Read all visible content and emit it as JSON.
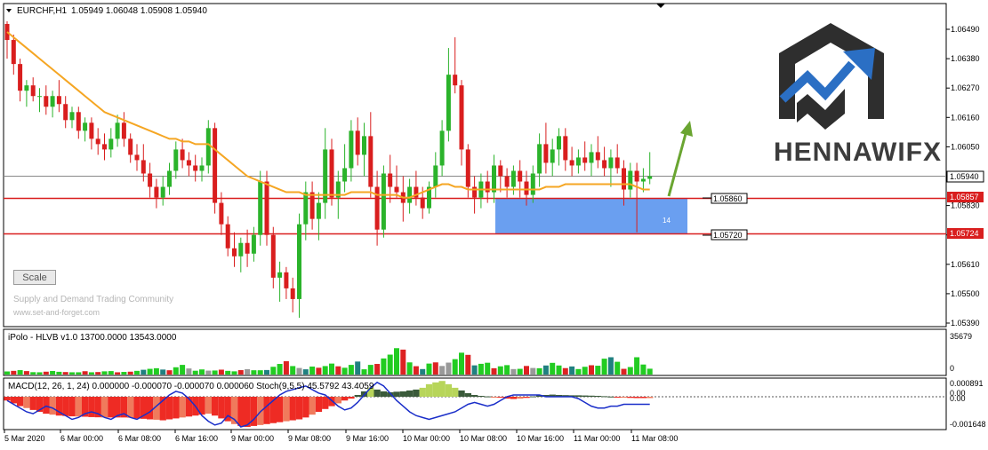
{
  "header": {
    "symbol_label": "EURCHF,H1",
    "ohlc": "1.05949 1.06048 1.05908 1.05940"
  },
  "colors": {
    "bull": "#2bb32b",
    "bear": "#d91e1e",
    "ma": "#f5a623",
    "support_line": "#d91e1e",
    "zone": "#6a9ff0",
    "arrow": "#6aa531",
    "macd_bar": "#ee2b24",
    "macd_bar_light": "#f07a5c",
    "stoch_main": "#1a2ec9",
    "stoch_signal": "#b7d55a",
    "vol_green": "#22cc22",
    "vol_red": "#dd2222",
    "vol_teal": "#208080",
    "vol_gray": "#999999"
  },
  "scale_button": "Scale",
  "watermark": {
    "line1": "Supply and Demand Trading Community",
    "line2": "www.set-and-forget.com"
  },
  "logo": {
    "text": "HENNAWIFX"
  },
  "zone_label": "14",
  "price_axis": {
    "ticks": [
      "1.06490",
      "1.06380",
      "1.06270",
      "1.06160",
      "1.06050",
      "1.05830",
      "1.05720",
      "1.05610",
      "1.05500",
      "1.05390"
    ],
    "current_price": "1.05940",
    "level_upper": "1.05857",
    "level_lower": "1.05724",
    "marker_upper": "1.05860",
    "marker_lower": "1.05720"
  },
  "time_axis": [
    "5 Mar 2020",
    "6 Mar 00:00",
    "6 Mar 08:00",
    "6 Mar 16:00",
    "9 Mar 00:00",
    "9 Mar 08:00",
    "9 Mar 16:00",
    "10 Mar 00:00",
    "10 Mar 08:00",
    "10 Mar 16:00",
    "11 Mar 00:00",
    "11 Mar 08:00"
  ],
  "volume_panel": {
    "title": "iPolo - HLVB v1.0 13700.0000 13543.0000",
    "max_label": "35679",
    "min_label": "0"
  },
  "macd_panel": {
    "title": "MACD(12, 26, 1, 24) 0.000000 -0.000070 -0.000070 0.000060  Stoch(9,5,5) 45.5792 43.4059",
    "top_label": "0.000891",
    "zero_label1": "0.00",
    "zero_label2": "0.00",
    "bottom_label": "-0.001648"
  },
  "chart_data": {
    "type": "candlestick",
    "symbol": "EURCHF",
    "timeframe": "H1",
    "y_axis_ticks": [
      1.0649,
      1.0638,
      1.0627,
      1.0616,
      1.0605,
      1.0583,
      1.0572,
      1.0561,
      1.055,
      1.0539
    ],
    "current_price": 1.0594,
    "support_levels": [
      1.05857,
      1.05724
    ],
    "support_markers": [
      1.0586,
      1.0572
    ],
    "candles": [
      [
        1.0651,
        1.0652,
        1.0638,
        1.0645
      ],
      [
        1.0645,
        1.0647,
        1.0632,
        1.0636
      ],
      [
        1.0636,
        1.0638,
        1.0622,
        1.0626
      ],
      [
        1.0626,
        1.063,
        1.062,
        1.0628
      ],
      [
        1.0628,
        1.0631,
        1.0622,
        1.0624
      ],
      [
        1.0624,
        1.0627,
        1.0618,
        1.0624
      ],
      [
        1.0624,
        1.0628,
        1.0617,
        1.062
      ],
      [
        1.062,
        1.0626,
        1.0616,
        1.0624
      ],
      [
        1.0624,
        1.063,
        1.0618,
        1.0621
      ],
      [
        1.0621,
        1.0624,
        1.0612,
        1.0615
      ],
      [
        1.0615,
        1.062,
        1.0612,
        1.0618
      ],
      [
        1.0618,
        1.062,
        1.0608,
        1.0611
      ],
      [
        1.0611,
        1.0616,
        1.0607,
        1.0614
      ],
      [
        1.0614,
        1.0616,
        1.0604,
        1.0608
      ],
      [
        1.0608,
        1.0612,
        1.0602,
        1.0606
      ],
      [
        1.0606,
        1.061,
        1.06,
        1.0604
      ],
      [
        1.0604,
        1.0612,
        1.0601,
        1.0608
      ],
      [
        1.0608,
        1.0617,
        1.0605,
        1.0614
      ],
      [
        1.0614,
        1.0618,
        1.0605,
        1.0608
      ],
      [
        1.0608,
        1.061,
        1.0599,
        1.0602
      ],
      [
        1.0602,
        1.0606,
        1.0596,
        1.06
      ],
      [
        1.06,
        1.0606,
        1.0592,
        1.0595
      ],
      [
        1.0595,
        1.0599,
        1.0586,
        1.059
      ],
      [
        1.059,
        1.0593,
        1.0582,
        1.0586
      ],
      [
        1.0586,
        1.0594,
        1.0583,
        1.059
      ],
      [
        1.059,
        1.0599,
        1.0587,
        1.0596
      ],
      [
        1.0596,
        1.0607,
        1.0593,
        1.0604
      ],
      [
        1.0604,
        1.0608,
        1.0597,
        1.06
      ],
      [
        1.06,
        1.0603,
        1.0594,
        1.0598
      ],
      [
        1.0598,
        1.0602,
        1.0592,
        1.0596
      ],
      [
        1.0596,
        1.0601,
        1.0592,
        1.0598
      ],
      [
        1.0598,
        1.0615,
        1.0595,
        1.0612
      ],
      [
        1.0612,
        1.0614,
        1.058,
        1.0584
      ],
      [
        1.0584,
        1.0588,
        1.0572,
        1.0576
      ],
      [
        1.0576,
        1.0579,
        1.0564,
        1.0567
      ],
      [
        1.0567,
        1.0573,
        1.056,
        1.0564
      ],
      [
        1.0564,
        1.0571,
        1.0558,
        1.0569
      ],
      [
        1.0569,
        1.0574,
        1.056,
        1.0565
      ],
      [
        1.0565,
        1.0575,
        1.0562,
        1.0572
      ],
      [
        1.0572,
        1.0596,
        1.0568,
        1.0592
      ],
      [
        1.0592,
        1.0596,
        1.0568,
        1.0572
      ],
      [
        1.0572,
        1.0575,
        1.0552,
        1.0556
      ],
      [
        1.0556,
        1.0562,
        1.0547,
        1.0558
      ],
      [
        1.0558,
        1.056,
        1.0548,
        1.0552
      ],
      [
        1.0552,
        1.0556,
        1.0543,
        1.0548
      ],
      [
        1.0548,
        1.058,
        1.0541,
        1.0576
      ],
      [
        1.0576,
        1.0592,
        1.057,
        1.0588
      ],
      [
        1.0588,
        1.0592,
        1.0574,
        1.0578
      ],
      [
        1.0578,
        1.0588,
        1.057,
        1.0584
      ],
      [
        1.0584,
        1.0612,
        1.0578,
        1.0604
      ],
      [
        1.0604,
        1.0608,
        1.0583,
        1.0586
      ],
      [
        1.0586,
        1.0596,
        1.0578,
        1.0592
      ],
      [
        1.0592,
        1.0606,
        1.0588,
        1.0597
      ],
      [
        1.0597,
        1.0615,
        1.0592,
        1.0611
      ],
      [
        1.0611,
        1.0616,
        1.0598,
        1.0602
      ],
      [
        1.0602,
        1.0614,
        1.0594,
        1.0609
      ],
      [
        1.0609,
        1.0618,
        1.0586,
        1.059
      ],
      [
        1.059,
        1.0596,
        1.0568,
        1.0574
      ],
      [
        1.0574,
        1.0598,
        1.0571,
        1.0595
      ],
      [
        1.0595,
        1.0602,
        1.0584,
        1.059
      ],
      [
        1.059,
        1.0598,
        1.0586,
        1.0588
      ],
      [
        1.0588,
        1.0594,
        1.0577,
        1.0584
      ],
      [
        1.0584,
        1.0593,
        1.058,
        1.059
      ],
      [
        1.059,
        1.0596,
        1.0583,
        1.0586
      ],
      [
        1.0586,
        1.059,
        1.0578,
        1.0582
      ],
      [
        1.0582,
        1.0592,
        1.058,
        1.059
      ],
      [
        1.059,
        1.0603,
        1.0586,
        1.0598
      ],
      [
        1.0598,
        1.0615,
        1.0594,
        1.0611
      ],
      [
        1.0611,
        1.0642,
        1.0607,
        1.0632
      ],
      [
        1.0632,
        1.0646,
        1.0625,
        1.0628
      ],
      [
        1.0628,
        1.063,
        1.0598,
        1.0604
      ],
      [
        1.0604,
        1.0606,
        1.0586,
        1.059
      ],
      [
        1.059,
        1.0594,
        1.058,
        1.0586
      ],
      [
        1.0586,
        1.0595,
        1.0582,
        1.0592
      ],
      [
        1.0592,
        1.0596,
        1.0584,
        1.0588
      ],
      [
        1.0588,
        1.0602,
        1.0584,
        1.0598
      ],
      [
        1.0598,
        1.06,
        1.0588,
        1.0594
      ],
      [
        1.0594,
        1.0597,
        1.0586,
        1.059
      ],
      [
        1.059,
        1.0598,
        1.0587,
        1.0596
      ],
      [
        1.0596,
        1.06,
        1.0586,
        1.0592
      ],
      [
        1.0592,
        1.0596,
        1.0583,
        1.0587
      ],
      [
        1.0587,
        1.0598,
        1.0584,
        1.0595
      ],
      [
        1.0595,
        1.061,
        1.059,
        1.0606
      ],
      [
        1.0606,
        1.0614,
        1.0595,
        1.0599
      ],
      [
        1.0599,
        1.0608,
        1.0594,
        1.0604
      ],
      [
        1.0604,
        1.0612,
        1.0598,
        1.0609
      ],
      [
        1.0609,
        1.0612,
        1.0596,
        1.06
      ],
      [
        1.06,
        1.0605,
        1.0594,
        1.0598
      ],
      [
        1.0598,
        1.0604,
        1.0595,
        1.0601
      ],
      [
        1.0601,
        1.0607,
        1.0596,
        1.0599
      ],
      [
        1.0599,
        1.0606,
        1.0594,
        1.0603
      ],
      [
        1.0603,
        1.0609,
        1.0597,
        1.06
      ],
      [
        1.06,
        1.0605,
        1.0594,
        1.0597
      ],
      [
        1.0597,
        1.0604,
        1.059,
        1.0601
      ],
      [
        1.0601,
        1.0606,
        1.0595,
        1.0597
      ],
      [
        1.0597,
        1.06,
        1.0583,
        1.0589
      ],
      [
        1.0589,
        1.0599,
        1.0586,
        1.0596
      ],
      [
        1.0596,
        1.0599,
        1.0573,
        1.0592
      ],
      [
        1.0592,
        1.0597,
        1.0588,
        1.0593
      ],
      [
        1.0593,
        1.0603,
        1.0591,
        1.0594
      ]
    ],
    "ma_values": [
      1.0648,
      1.0646,
      1.0644,
      1.0642,
      1.064,
      1.0638,
      1.0636,
      1.0634,
      1.0632,
      1.063,
      1.0628,
      1.0626,
      1.0624,
      1.0622,
      1.062,
      1.0618,
      1.0617,
      1.0616,
      1.0615,
      1.0614,
      1.0613,
      1.0612,
      1.0611,
      1.061,
      1.0609,
      1.0608,
      1.0608,
      1.0607,
      1.0607,
      1.0606,
      1.0606,
      1.0606,
      1.0604,
      1.0602,
      1.06,
      1.0598,
      1.0596,
      1.0594,
      1.0593,
      1.0592,
      1.0591,
      1.059,
      1.0589,
      1.0588,
      1.0588,
      1.0588,
      1.0587,
      1.0587,
      1.0587,
      1.0587,
      1.0587,
      1.0587,
      1.0587,
      1.0588,
      1.0588,
      1.0588,
      1.0588,
      1.0587,
      1.0587,
      1.0587,
      1.0587,
      1.0586,
      1.0586,
      1.0587,
      1.0588,
      1.0589,
      1.059,
      1.0591,
      1.0591,
      1.059,
      1.059,
      1.0589,
      1.0589,
      1.0589,
      1.0589,
      1.0589,
      1.0589,
      1.0589,
      1.0589,
      1.0589,
      1.0589,
      1.0589,
      1.0589,
      1.059,
      1.059,
      1.059,
      1.0591,
      1.0591,
      1.0591,
      1.0591,
      1.0591,
      1.0591,
      1.0591,
      1.0591,
      1.0591,
      1.0591,
      1.0591,
      1.059,
      1.0589,
      1.0589
    ],
    "volume_ylim": [
      0,
      35679
    ],
    "volume": [
      2600,
      3100,
      3700,
      2900,
      2000,
      1900,
      2400,
      3000,
      2300,
      2100,
      1900,
      1900,
      2800,
      1900,
      2100,
      2700,
      2900,
      1900,
      2200,
      2400,
      3100,
      4000,
      4800,
      5300,
      4200,
      3600,
      6100,
      8100,
      5100,
      3200,
      4300,
      3300,
      3400,
      4100,
      3100,
      2700,
      3700,
      4500,
      3600,
      3600,
      3800,
      6500,
      8900,
      11200,
      7100,
      5500,
      4400,
      6700,
      5700,
      7100,
      9200,
      6900,
      5700,
      8100,
      10900,
      4400,
      8100,
      8900,
      13500,
      16700,
      22100,
      20900,
      10200,
      7000,
      4600,
      9200,
      10200,
      7200,
      10000,
      12900,
      18300,
      16500,
      7700,
      9000,
      9900,
      5300,
      6900,
      7900,
      4600,
      4800,
      7200,
      5500,
      5300,
      7600,
      9800,
      7600,
      5400,
      6800,
      4600,
      6500,
      7800,
      7400,
      13300,
      14500,
      10700,
      4800,
      6300,
      14500,
      8400,
      4900
    ],
    "volume_kind": [
      "g",
      "r",
      "g",
      "r",
      "g",
      "g",
      "r",
      "g",
      "g",
      "r",
      "g",
      "g",
      "r",
      "g",
      "r",
      "g",
      "g",
      "r",
      "g",
      "r",
      "g",
      "t",
      "g",
      "g",
      "t",
      "r",
      "g",
      "g",
      "gr",
      "g",
      "g",
      "gr",
      "g",
      "r",
      "g",
      "g",
      "r",
      "gr",
      "g",
      "g",
      "t",
      "g",
      "g",
      "r",
      "g",
      "gr",
      "t",
      "g",
      "r",
      "g",
      "g",
      "r",
      "g",
      "g",
      "t",
      "g",
      "g",
      "r",
      "g",
      "g",
      "g",
      "r",
      "g",
      "r",
      "t",
      "g",
      "r",
      "gr",
      "gr",
      "g",
      "g",
      "r",
      "t",
      "g",
      "g",
      "r",
      "g",
      "g",
      "gr",
      "g",
      "r",
      "gr",
      "g",
      "t",
      "g",
      "g",
      "r",
      "t",
      "g",
      "g",
      "r",
      "g",
      "g",
      "t",
      "g",
      "r",
      "g",
      "g",
      "g",
      "g"
    ],
    "macd_hist": [
      -0.0002,
      -0.00035,
      -0.0005,
      -0.0006,
      -0.0007,
      -0.0008,
      -0.0009,
      -0.00095,
      -0.001,
      -0.00102,
      -0.00104,
      -0.00105,
      -0.00106,
      -0.00108,
      -0.00109,
      -0.0011,
      -0.0011,
      -0.0011,
      -0.0011,
      -0.00112,
      -0.00115,
      -0.00117,
      -0.0012,
      -0.00122,
      -0.00125,
      -0.0012,
      -0.00115,
      -0.0011,
      -0.00105,
      -0.001,
      -0.00095,
      -0.0009,
      -0.001,
      -0.00115,
      -0.0013,
      -0.00145,
      -0.00155,
      -0.0016,
      -0.00155,
      -0.0015,
      -0.00145,
      -0.0014,
      -0.00135,
      -0.0013,
      -0.00125,
      -0.0012,
      -0.0011,
      -0.00095,
      -0.0008,
      -0.00065,
      -0.0005,
      -0.00035,
      -0.0002,
      -0.0001,
      0.0001,
      0.0003,
      0.0005,
      0.0004,
      0.0003,
      0.00025,
      0.00028,
      0.0003,
      0.00035,
      0.0004,
      0.0005,
      0.0007,
      0.0008,
      0.00088,
      0.0007,
      0.0005,
      0.00035,
      0.0002,
      0.0001,
      5e-05,
      2e-05,
      -2e-05,
      -5e-05,
      -0.0001,
      -0.00012,
      -0.0001,
      -6e-05,
      2e-05,
      8e-05,
      0.0001,
      0.00012,
      0.0001,
      9e-05,
      8e-05,
      8e-05,
      7e-05,
      6e-05,
      5e-05,
      3e-05,
      1e-05,
      -2e-05,
      -5e-05,
      -6e-05,
      -7e-05,
      -7e-05,
      -7e-05
    ],
    "stoch_main": [
      -0.0002,
      -0.0004,
      -0.0006,
      -0.0008,
      -0.0009,
      -0.0007,
      -0.0005,
      -0.0006,
      -0.0008,
      -0.001,
      -0.0012,
      -0.0011,
      -0.0009,
      -0.0008,
      -0.0009,
      -0.0011,
      -0.0012,
      -0.001,
      -0.0009,
      -0.0011,
      -0.0012,
      -0.001,
      -0.0008,
      -0.0005,
      -0.0002,
      0.0001,
      0.0003,
      0.0002,
      -0.0001,
      -0.0005,
      -0.001,
      -0.0013,
      -0.0015,
      -0.0014,
      -0.001,
      -0.0012,
      -0.0016,
      -0.0015,
      -0.0012,
      -0.0008,
      -0.0005,
      -0.0002,
      0.0001,
      0.0003,
      0.0004,
      0.0005,
      0.0006,
      0.0004,
      0.0002,
      0.0001,
      -0.0002,
      -0.0005,
      -0.0007,
      -0.0006,
      -0.0003,
      0.0001,
      0.0005,
      0.0008,
      0.0006,
      0.0002,
      -0.0002,
      -0.0005,
      -0.0008,
      -0.001,
      -0.0011,
      -0.0012,
      -0.0011,
      -0.001,
      -0.0009,
      -0.0008,
      -0.0006,
      -0.0004,
      -0.0003,
      -0.0004,
      -0.0005,
      -0.0004,
      -0.0002,
      0,
      0.0001,
      0.0001,
      0.0001,
      0.0001,
      0.0001,
      0,
      0,
      0,
      0,
      0,
      -0.0001,
      -0.0003,
      -0.0005,
      -0.0006,
      -0.0006,
      -0.0005,
      -0.0005,
      -0.0004,
      -0.0004,
      -0.0004,
      -0.0004,
      -0.0004
    ]
  }
}
